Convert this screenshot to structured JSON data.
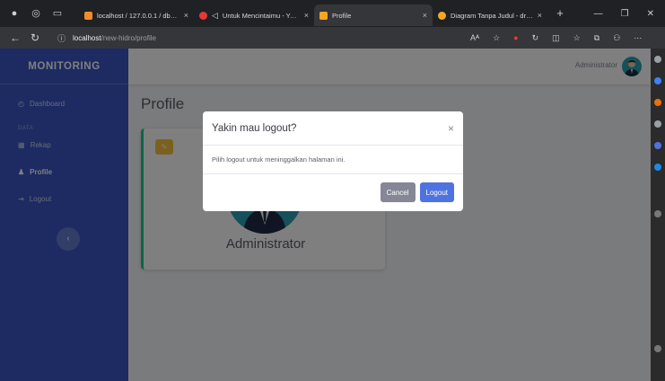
{
  "browser": {
    "tabs": [
      {
        "title": "localhost / 127.0.0.1 / db_new...",
        "fav_color": "#f28c28"
      },
      {
        "title": "Untuk Mencintaimu - You...",
        "fav_color": "#e53935"
      },
      {
        "title": "Profile",
        "fav_color": "#f6a623"
      },
      {
        "title": "Diagram Tanpa Judul - draw.io",
        "fav_color": "#f5a623"
      }
    ],
    "url_host": "localhost",
    "url_path": "/new-hidro/profile"
  },
  "sidebar": {
    "brand": "MONITORING",
    "items": [
      {
        "label": "Dashboard",
        "icon": "dashboard-icon"
      },
      {
        "label": "Rekap",
        "icon": "table-icon"
      },
      {
        "label": "Profile",
        "icon": "user-icon"
      },
      {
        "label": "Logout",
        "icon": "logout-icon"
      }
    ],
    "section_heading": "DATA",
    "toggle_icon": "chevron-left-icon"
  },
  "topbar": {
    "user_name": "Administrator"
  },
  "main": {
    "title": "Profile",
    "card": {
      "name": "Administrator",
      "edit_icon": "edit-icon"
    }
  },
  "modal": {
    "title": "Yakin mau logout?",
    "body": "Pilih logout untuk meninggalkan halaman ini.",
    "cancel_label": "Cancel",
    "logout_label": "Logout"
  },
  "colors": {
    "sidebar": "#3a57c4",
    "primary": "#4e73df",
    "secondary": "#858796",
    "success": "#1cc88a",
    "warning": "#f6c23e"
  }
}
